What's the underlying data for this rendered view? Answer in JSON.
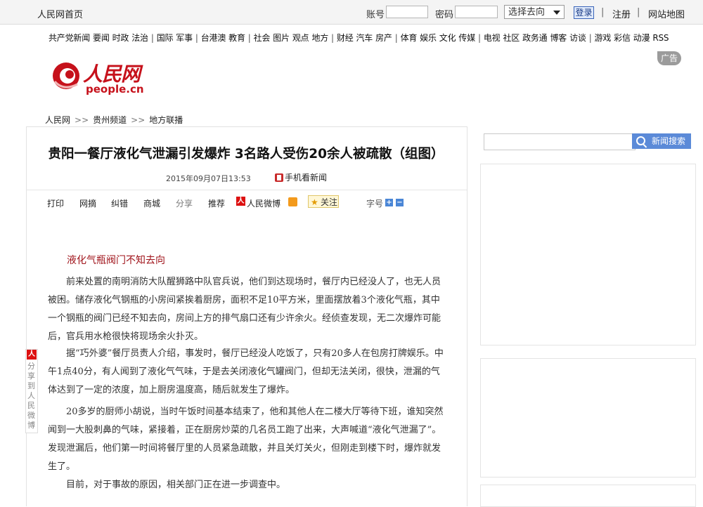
{
  "topbar": {
    "home": "人民网首页",
    "account_label": "账号",
    "password_label": "密码",
    "select_value": "选择去向",
    "login": "登录",
    "register": "注册",
    "sitemap": "网站地图",
    "sep": "|"
  },
  "nav": {
    "groups": [
      [
        "共产党新闻",
        "要闻",
        "时政",
        "法治"
      ],
      [
        "国际",
        "军事"
      ],
      [
        "台港澳",
        "教育"
      ],
      [
        "社会",
        "图片",
        "观点",
        "地方"
      ],
      [
        "财经",
        "汽车",
        "房产"
      ],
      [
        "体育",
        "娱乐",
        "文化",
        "传媒"
      ],
      [
        "电视",
        "社区",
        "政务通",
        "博客",
        "访谈"
      ],
      [
        "游戏",
        "彩信",
        "动漫",
        "RSS"
      ]
    ]
  },
  "logo": {
    "name": "人民网",
    "sub": "people.cn"
  },
  "ad": "广告",
  "breadcrumb": [
    "人民网",
    "贵州频道",
    "地方联播"
  ],
  "breadcrumb_sep": ">>",
  "article": {
    "title": "贵阳一餐厅液化气泄漏引发爆炸 3名路人受伤20余人被疏散（组图）",
    "date": "2015年09月07日13:53",
    "phone_read": "手机看新闻",
    "tools": [
      "打印",
      "网摘",
      "纠错",
      "商城",
      "分享",
      "推荐"
    ],
    "weibo": "人民微博",
    "follow": "关注",
    "font_size": "字号",
    "subhead": "液化气瓶阀门不知去向",
    "paragraphs": [
      "前来处置的南明消防大队醒狮路中队官兵说，他们到达现场时，餐厅内已经没人了，也无人员被困。储存液化气钢瓶的小房间紧挨着厨房，面积不足10平方米，里面摆放着3个液化气瓶，其中一个钢瓶的阀门已经不知去向，房间上方的排气扇口还有少许余火。经侦查发现，无二次爆炸可能后，官兵用水枪很快将现场余火扑灭。",
      "据“巧外婆”餐厅员责人介绍，事发时，餐厅已经没人吃饭了，只有20多人在包房打牌娱乐。中午1点40分，有人闻到了液化气气味，于是去关闭液化气罐阀门，但却无法关闭，很快，泄漏的气体达到了一定的浓度，加上厨房温度高，随后就发生了爆炸。",
      "20多岁的厨师小胡说，当时午饭时间基本结束了，他和其他人在二楼大厅等待下班，谁知突然闻到一大股刺鼻的气味，紧接着，正在厨房炒菜的几名员工跑了出来，大声喊道“液化气泄漏了”。发现泄漏后，他们第一时间将餐厅里的人员紧急疏散，并且关灯关火，但刚走到楼下时，爆炸就发生了。",
      "目前，对于事故的原因，相关部门正在进一步调查中。"
    ]
  },
  "share_vertical": {
    "icon": "人",
    "text": "分享到人民微博"
  },
  "sidebar": {
    "search_button": "新闻搜索"
  }
}
